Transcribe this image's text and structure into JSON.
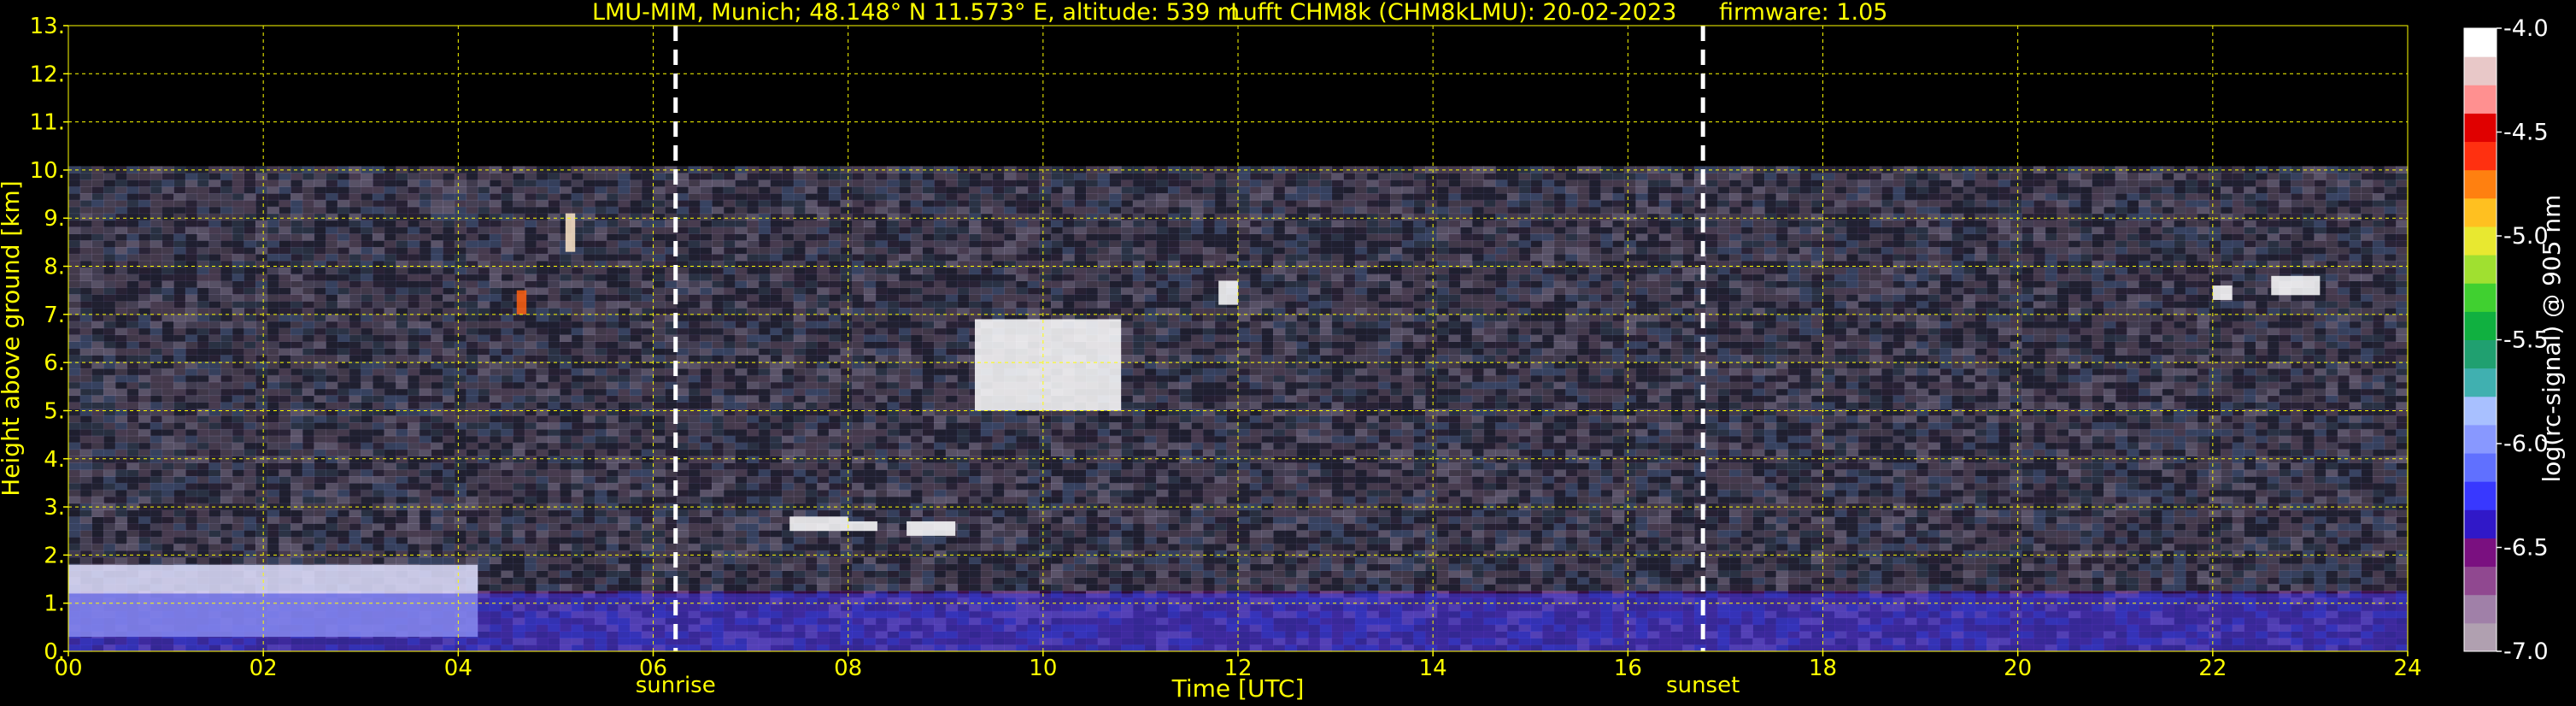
{
  "chart_data": {
    "type": "heatmap",
    "title_station": "LMU-MIM, Munich; 48.148° N 11.573° E, altitude: 539 m",
    "title_instrument": "Lufft CHM8k (CHM8kLMU): 20-02-2023",
    "title_firmware": "firmware: 1.05",
    "xlabel": "Time [UTC]",
    "ylabel": "Height above ground [km]",
    "xlim": [
      0,
      24
    ],
    "ylim": [
      0,
      13
    ],
    "x_ticks": [
      "00",
      "02",
      "04",
      "06",
      "08",
      "10",
      "12",
      "14",
      "16",
      "18",
      "20",
      "22",
      "24"
    ],
    "y_ticks": [
      "0.",
      "1.",
      "2.",
      "3.",
      "4.",
      "5.",
      "6.",
      "7.",
      "8.",
      "9.",
      "10.",
      "11.",
      "12.",
      "13."
    ],
    "grid": true,
    "grid_color": "#ffff00",
    "data_max_height_km": 10,
    "events": [
      {
        "name": "sunrise",
        "time": 6.23
      },
      {
        "name": "sunset",
        "time": 16.77
      }
    ],
    "colorbar": {
      "label": "log(rc-signal) @ 905 nm",
      "range": [
        -7.0,
        -4.0
      ],
      "ticks": [
        "-4.0",
        "-4.5",
        "-5.0",
        "-5.5",
        "-6.0",
        "-6.5",
        "-7.0"
      ],
      "colors": [
        "#b0a0b0",
        "#a080a8",
        "#904890",
        "#7a1080",
        "#3018c8",
        "#3838ff",
        "#6070ff",
        "#8898ff",
        "#a8c0ff",
        "#40b0b0",
        "#20a070",
        "#10b040",
        "#40d030",
        "#a0e030",
        "#e8e830",
        "#ffc020",
        "#ff8010",
        "#ff3010",
        "#e00000",
        "#ff9090",
        "#e8c8c8",
        "#ffffff"
      ]
    },
    "features": [
      {
        "name": "boundary layer / residual layer",
        "t_start": 0,
        "t_end": 4.2,
        "z_bottom": 0.3,
        "z_top": 1.8,
        "level": "-5.0 to -4.0"
      },
      {
        "name": "aerosol layer",
        "t_start": 0,
        "t_end": 24,
        "z_bottom": 0,
        "z_top": 1.2,
        "level": "-6.5 to -6.3"
      },
      {
        "name": "cloud",
        "t_start": 9.3,
        "t_end": 10.8,
        "z_bottom": 5.0,
        "z_top": 6.9,
        "level": "-4.0"
      },
      {
        "name": "cloud",
        "t_start": 7.4,
        "t_end": 8.0,
        "z_bottom": 2.5,
        "z_top": 2.8,
        "level": "-4.0"
      },
      {
        "name": "cloud",
        "t_start": 8.0,
        "t_end": 8.3,
        "z_bottom": 2.5,
        "z_top": 2.7,
        "level": "-4.0"
      },
      {
        "name": "cloud",
        "t_start": 8.6,
        "t_end": 9.1,
        "z_bottom": 2.4,
        "z_top": 2.7,
        "level": "-4.0"
      },
      {
        "name": "cloud",
        "t_start": 11.8,
        "t_end": 12.0,
        "z_bottom": 7.2,
        "z_top": 7.7,
        "level": "-4.0"
      },
      {
        "name": "cloud",
        "t_start": 22.6,
        "t_end": 23.1,
        "z_bottom": 7.4,
        "z_top": 7.8,
        "level": "-4.0"
      },
      {
        "name": "cloud",
        "t_start": 22.0,
        "t_end": 22.2,
        "z_bottom": 7.3,
        "z_top": 7.6,
        "level": "-4.0"
      },
      {
        "name": "cloud",
        "t_start": 5.1,
        "t_end": 5.2,
        "z_bottom": 8.3,
        "z_top": 9.1,
        "level": "-4.5"
      },
      {
        "name": "cloud",
        "t_start": 4.6,
        "t_end": 4.7,
        "z_bottom": 7.0,
        "z_top": 7.5,
        "level": "-5.5"
      }
    ]
  }
}
